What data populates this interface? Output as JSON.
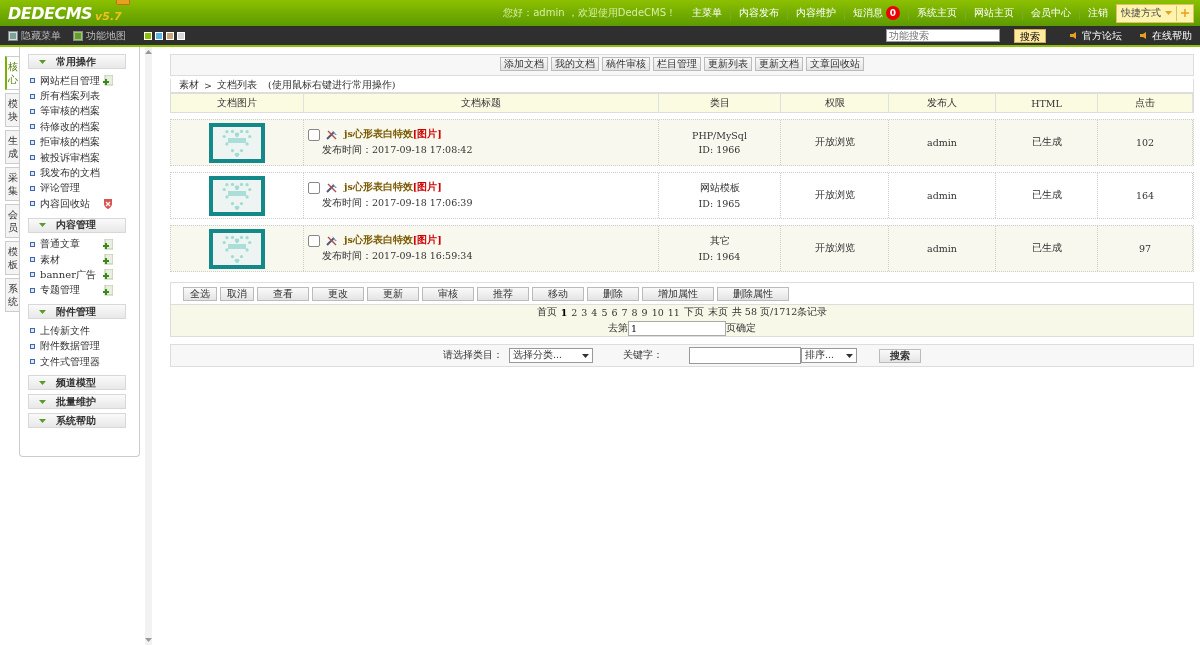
{
  "header": {
    "logo": "DEDECMS",
    "version": "v5.7",
    "greeting": "您好：admin ，欢迎使用DedeCMS！",
    "nav": [
      {
        "label": "主菜单"
      },
      {
        "label": "内容发布"
      },
      {
        "label": "内容维护"
      },
      {
        "label": "短消息",
        "badge": "0"
      },
      {
        "label": "系统主页"
      },
      {
        "label": "网站主页"
      },
      {
        "label": "会员中心"
      },
      {
        "label": "注销"
      }
    ],
    "quick": "快捷方式"
  },
  "toolbar": {
    "links": [
      "隐藏菜单",
      "功能地图"
    ],
    "search": {
      "placeholder": "功能搜索",
      "button": "搜索"
    },
    "right_links": [
      "官方论坛",
      "在线帮助"
    ]
  },
  "side_tabs": [
    {
      "label": "核心",
      "selected": true
    },
    {
      "label": "模块",
      "selected": false
    },
    {
      "label": "生成",
      "selected": false
    },
    {
      "label": "采集",
      "selected": false
    },
    {
      "label": "会员",
      "selected": false
    },
    {
      "label": "模板",
      "selected": false
    },
    {
      "label": "系统",
      "selected": false
    }
  ],
  "sidebar": [
    {
      "title": "常用操作",
      "items": [
        {
          "label": "网站栏目管理",
          "kind": "add"
        },
        {
          "label": "所有档案列表",
          "kind": "plain"
        },
        {
          "label": "等审核的档案",
          "kind": "plain"
        },
        {
          "label": "待修改的档案",
          "kind": "plain"
        },
        {
          "label": "拒审核的档案",
          "kind": "plain"
        },
        {
          "label": "被投诉审档案",
          "kind": "plain"
        },
        {
          "label": "我发布的文档",
          "kind": "plain"
        },
        {
          "label": "评论管理",
          "kind": "plain"
        },
        {
          "label": "内容回收站",
          "kind": "recycle"
        }
      ]
    },
    {
      "title": "内容管理",
      "items": [
        {
          "label": "普通文章",
          "kind": "add"
        },
        {
          "label": "素材",
          "kind": "add"
        },
        {
          "label": "banner广告",
          "kind": "add"
        },
        {
          "label": "专题管理",
          "kind": "add"
        }
      ]
    },
    {
      "title": "附件管理",
      "items": [
        {
          "label": "上传新文件",
          "kind": "plain"
        },
        {
          "label": "附件数据管理",
          "kind": "plain"
        },
        {
          "label": "文件式管理器",
          "kind": "plain"
        }
      ]
    },
    {
      "title": "频道模型"
    },
    {
      "title": "批量维护"
    },
    {
      "title": "系统帮助"
    }
  ],
  "actions": [
    "添加文档",
    "我的文档",
    "稿件审核",
    "栏目管理",
    "更新列表",
    "更新文档",
    "文章回收站"
  ],
  "breadcrumb": {
    "parts": [
      "素材",
      ">",
      "文档列表"
    ],
    "hint": "(使用鼠标右键进行常用操作)"
  },
  "table": {
    "columns": [
      "文档图片",
      "文档标题",
      "类目",
      "权限",
      "发布人",
      "HTML",
      "点击"
    ],
    "rows": [
      {
        "checked": false,
        "title": "js心形表白特效",
        "tag": "[图片]",
        "time": "发布时间：2017-09-18 17:08:42",
        "category": "PHP/MySql",
        "id": "ID: 1966",
        "access": "开放浏览",
        "author": "admin",
        "html": "已生成",
        "clicks": "102"
      },
      {
        "checked": false,
        "title": "js心形表白特效",
        "tag": "[图片]",
        "time": "发布时间：2017-09-18 17:06:39",
        "category": "网站模板",
        "id": "ID: 1965",
        "access": "开放浏览",
        "author": "admin",
        "html": "已生成",
        "clicks": "164"
      },
      {
        "checked": false,
        "title": "js心形表白特效",
        "tag": "[图片]",
        "time": "发布时间：2017-09-18 16:59:34",
        "category": "其它",
        "id": "ID: 1964",
        "access": "开放浏览",
        "author": "admin",
        "html": "已生成",
        "clicks": "97"
      }
    ]
  },
  "bulk_buttons": [
    "全选",
    "取消",
    "查看",
    "更改",
    "更新",
    "审核",
    "推荐",
    "移动",
    "删除",
    "增加属性",
    "删除属性"
  ],
  "pager": {
    "first": "首页",
    "pages": [
      {
        "label": "1",
        "selected": true
      },
      {
        "label": "2",
        "selected": false
      },
      {
        "label": "3",
        "selected": false
      },
      {
        "label": "4",
        "selected": false
      },
      {
        "label": "5",
        "selected": false
      },
      {
        "label": "6",
        "selected": false
      },
      {
        "label": "7",
        "selected": false
      },
      {
        "label": "8",
        "selected": false
      },
      {
        "label": "9",
        "selected": false
      },
      {
        "label": "10",
        "selected": false
      },
      {
        "label": "11",
        "selected": false
      }
    ],
    "next": "下页",
    "last": "末页",
    "total": "共 58 页/1712条记录",
    "goto_label": "去第",
    "goto_value": "1",
    "goto_confirm": "页确定"
  },
  "filter": {
    "category_label": "请选择类目：",
    "category_select": "选择分类...",
    "keyword_label": "关键字：",
    "sort_select": "排序...",
    "button": "搜索"
  }
}
